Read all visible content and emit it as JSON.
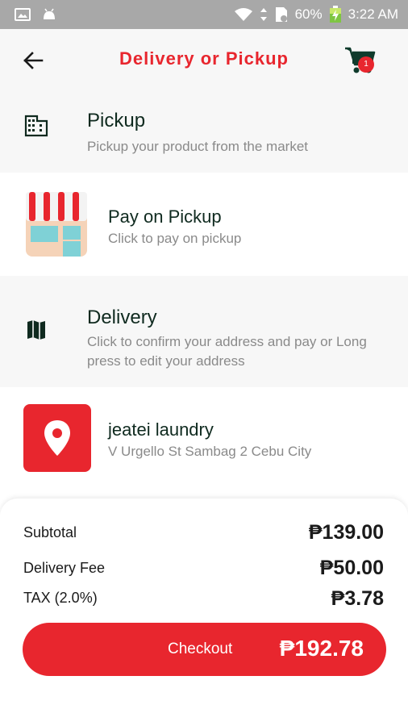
{
  "status_bar": {
    "battery": "60%",
    "time": "3:22 AM"
  },
  "header": {
    "title": "Delivery or Pickup",
    "cart_count": "1"
  },
  "pickup_section": {
    "title": "Pickup",
    "subtitle": "Pickup your product from the market"
  },
  "pickup_option": {
    "title": "Pay on Pickup",
    "subtitle": "Click to pay on pickup"
  },
  "delivery_section": {
    "title": "Delivery",
    "subtitle": "Click to confirm your address and pay or Long press to edit your address"
  },
  "delivery_option": {
    "title": "jeatei laundry",
    "subtitle": "V Urgello St Sambag 2 Cebu City"
  },
  "summary": {
    "subtotal_label": "Subtotal",
    "subtotal_value": "₱139.00",
    "delivery_fee_label": "Delivery Fee",
    "delivery_fee_value": "₱50.00",
    "tax_label": "TAX (2.0%)",
    "tax_value": "₱3.78"
  },
  "checkout": {
    "label": "Checkout",
    "total": "₱192.78"
  },
  "colors": {
    "accent": "#e8262e",
    "text_dark": "#0f2a1f",
    "text_muted": "#8a8a8a"
  },
  "icons": [
    "back-arrow-icon",
    "cart-icon",
    "building-icon",
    "storefront-icon",
    "map-icon",
    "location-pin-icon"
  ]
}
